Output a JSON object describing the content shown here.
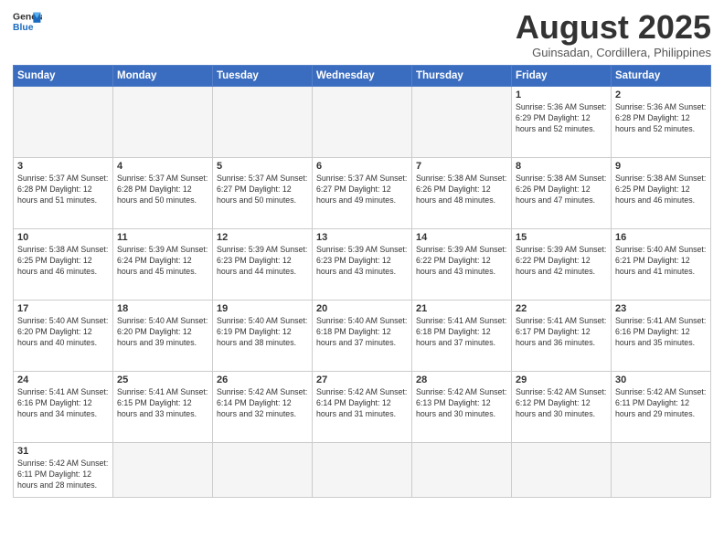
{
  "logo": {
    "text_general": "General",
    "text_blue": "Blue"
  },
  "header": {
    "title": "August 2025",
    "subtitle": "Guinsadan, Cordillera, Philippines"
  },
  "weekdays": [
    "Sunday",
    "Monday",
    "Tuesday",
    "Wednesday",
    "Thursday",
    "Friday",
    "Saturday"
  ],
  "weeks": [
    [
      {
        "day": "",
        "info": ""
      },
      {
        "day": "",
        "info": ""
      },
      {
        "day": "",
        "info": ""
      },
      {
        "day": "",
        "info": ""
      },
      {
        "day": "",
        "info": ""
      },
      {
        "day": "1",
        "info": "Sunrise: 5:36 AM\nSunset: 6:29 PM\nDaylight: 12 hours\nand 52 minutes."
      },
      {
        "day": "2",
        "info": "Sunrise: 5:36 AM\nSunset: 6:28 PM\nDaylight: 12 hours\nand 52 minutes."
      }
    ],
    [
      {
        "day": "3",
        "info": "Sunrise: 5:37 AM\nSunset: 6:28 PM\nDaylight: 12 hours\nand 51 minutes."
      },
      {
        "day": "4",
        "info": "Sunrise: 5:37 AM\nSunset: 6:28 PM\nDaylight: 12 hours\nand 50 minutes."
      },
      {
        "day": "5",
        "info": "Sunrise: 5:37 AM\nSunset: 6:27 PM\nDaylight: 12 hours\nand 50 minutes."
      },
      {
        "day": "6",
        "info": "Sunrise: 5:37 AM\nSunset: 6:27 PM\nDaylight: 12 hours\nand 49 minutes."
      },
      {
        "day": "7",
        "info": "Sunrise: 5:38 AM\nSunset: 6:26 PM\nDaylight: 12 hours\nand 48 minutes."
      },
      {
        "day": "8",
        "info": "Sunrise: 5:38 AM\nSunset: 6:26 PM\nDaylight: 12 hours\nand 47 minutes."
      },
      {
        "day": "9",
        "info": "Sunrise: 5:38 AM\nSunset: 6:25 PM\nDaylight: 12 hours\nand 46 minutes."
      }
    ],
    [
      {
        "day": "10",
        "info": "Sunrise: 5:38 AM\nSunset: 6:25 PM\nDaylight: 12 hours\nand 46 minutes."
      },
      {
        "day": "11",
        "info": "Sunrise: 5:39 AM\nSunset: 6:24 PM\nDaylight: 12 hours\nand 45 minutes."
      },
      {
        "day": "12",
        "info": "Sunrise: 5:39 AM\nSunset: 6:23 PM\nDaylight: 12 hours\nand 44 minutes."
      },
      {
        "day": "13",
        "info": "Sunrise: 5:39 AM\nSunset: 6:23 PM\nDaylight: 12 hours\nand 43 minutes."
      },
      {
        "day": "14",
        "info": "Sunrise: 5:39 AM\nSunset: 6:22 PM\nDaylight: 12 hours\nand 43 minutes."
      },
      {
        "day": "15",
        "info": "Sunrise: 5:39 AM\nSunset: 6:22 PM\nDaylight: 12 hours\nand 42 minutes."
      },
      {
        "day": "16",
        "info": "Sunrise: 5:40 AM\nSunset: 6:21 PM\nDaylight: 12 hours\nand 41 minutes."
      }
    ],
    [
      {
        "day": "17",
        "info": "Sunrise: 5:40 AM\nSunset: 6:20 PM\nDaylight: 12 hours\nand 40 minutes."
      },
      {
        "day": "18",
        "info": "Sunrise: 5:40 AM\nSunset: 6:20 PM\nDaylight: 12 hours\nand 39 minutes."
      },
      {
        "day": "19",
        "info": "Sunrise: 5:40 AM\nSunset: 6:19 PM\nDaylight: 12 hours\nand 38 minutes."
      },
      {
        "day": "20",
        "info": "Sunrise: 5:40 AM\nSunset: 6:18 PM\nDaylight: 12 hours\nand 37 minutes."
      },
      {
        "day": "21",
        "info": "Sunrise: 5:41 AM\nSunset: 6:18 PM\nDaylight: 12 hours\nand 37 minutes."
      },
      {
        "day": "22",
        "info": "Sunrise: 5:41 AM\nSunset: 6:17 PM\nDaylight: 12 hours\nand 36 minutes."
      },
      {
        "day": "23",
        "info": "Sunrise: 5:41 AM\nSunset: 6:16 PM\nDaylight: 12 hours\nand 35 minutes."
      }
    ],
    [
      {
        "day": "24",
        "info": "Sunrise: 5:41 AM\nSunset: 6:16 PM\nDaylight: 12 hours\nand 34 minutes."
      },
      {
        "day": "25",
        "info": "Sunrise: 5:41 AM\nSunset: 6:15 PM\nDaylight: 12 hours\nand 33 minutes."
      },
      {
        "day": "26",
        "info": "Sunrise: 5:42 AM\nSunset: 6:14 PM\nDaylight: 12 hours\nand 32 minutes."
      },
      {
        "day": "27",
        "info": "Sunrise: 5:42 AM\nSunset: 6:14 PM\nDaylight: 12 hours\nand 31 minutes."
      },
      {
        "day": "28",
        "info": "Sunrise: 5:42 AM\nSunset: 6:13 PM\nDaylight: 12 hours\nand 30 minutes."
      },
      {
        "day": "29",
        "info": "Sunrise: 5:42 AM\nSunset: 6:12 PM\nDaylight: 12 hours\nand 30 minutes."
      },
      {
        "day": "30",
        "info": "Sunrise: 5:42 AM\nSunset: 6:11 PM\nDaylight: 12 hours\nand 29 minutes."
      }
    ],
    [
      {
        "day": "31",
        "info": "Sunrise: 5:42 AM\nSunset: 6:11 PM\nDaylight: 12 hours\nand 28 minutes."
      },
      {
        "day": "",
        "info": ""
      },
      {
        "day": "",
        "info": ""
      },
      {
        "day": "",
        "info": ""
      },
      {
        "day": "",
        "info": ""
      },
      {
        "day": "",
        "info": ""
      },
      {
        "day": "",
        "info": ""
      }
    ]
  ]
}
